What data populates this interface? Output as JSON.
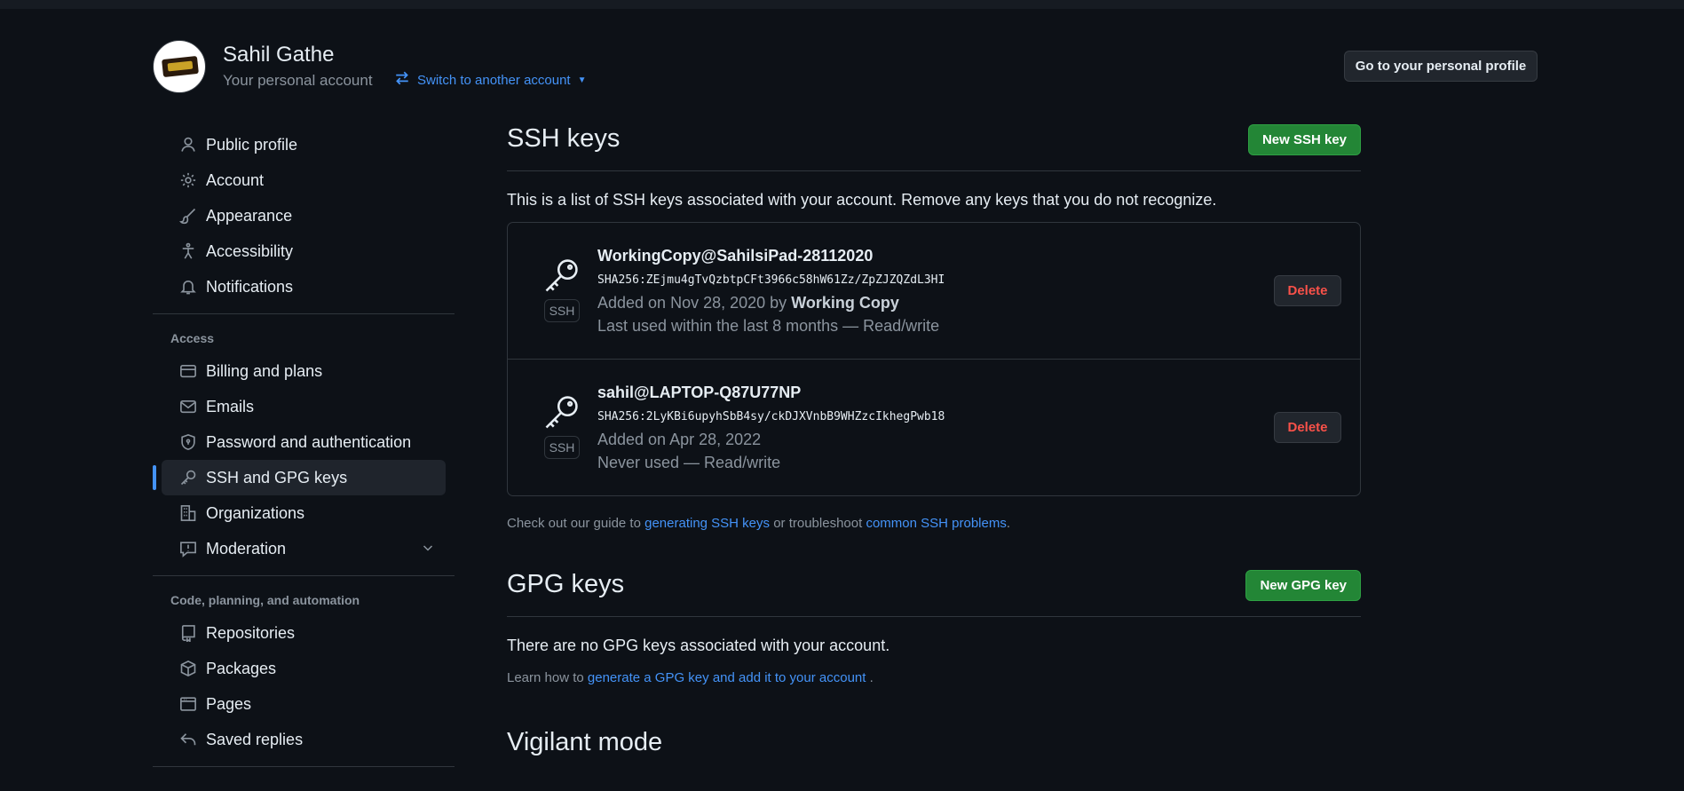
{
  "header": {
    "name": "Sahil Gathe",
    "subtitle": "Your personal account",
    "switch_label": "Switch to another account",
    "profile_button": "Go to your personal profile"
  },
  "sidebar": {
    "items_top": [
      {
        "label": "Public profile",
        "icon": "person-icon"
      },
      {
        "label": "Account",
        "icon": "gear-icon"
      },
      {
        "label": "Appearance",
        "icon": "paintbrush-icon"
      },
      {
        "label": "Accessibility",
        "icon": "accessibility-icon"
      },
      {
        "label": "Notifications",
        "icon": "bell-icon"
      }
    ],
    "access_heading": "Access",
    "items_access": [
      {
        "label": "Billing and plans",
        "icon": "credit-card-icon"
      },
      {
        "label": "Emails",
        "icon": "mail-icon"
      },
      {
        "label": "Password and authentication",
        "icon": "shield-lock-icon"
      },
      {
        "label": "SSH and GPG keys",
        "icon": "key-icon"
      },
      {
        "label": "Organizations",
        "icon": "organization-icon"
      },
      {
        "label": "Moderation",
        "icon": "report-icon"
      }
    ],
    "code_heading": "Code, planning, and automation",
    "items_code": [
      {
        "label": "Repositories",
        "icon": "repo-icon"
      },
      {
        "label": "Packages",
        "icon": "package-icon"
      },
      {
        "label": "Pages",
        "icon": "browser-icon"
      },
      {
        "label": "Saved replies",
        "icon": "reply-icon"
      }
    ]
  },
  "ssh": {
    "title": "SSH keys",
    "new_button": "New SSH key",
    "intro": "This is a list of SSH keys associated with your account. Remove any keys that you do not recognize.",
    "keys": [
      {
        "title": "WorkingCopy@SahilsiPad-28112020",
        "fingerprint": "SHA256:ZEjmu4gTvQzbtpCFt3966c58hW61Zz/ZpZJZQZdL3HI",
        "added_prefix": "Added on Nov 28, 2020 by",
        "added_by": "Working Copy",
        "used": "Last used within the last 8 months — Read/write",
        "badge": "SSH",
        "delete": "Delete"
      },
      {
        "title": "sahil@LAPTOP-Q87U77NP",
        "fingerprint": "SHA256:2LyKBi6upyhSbB4sy/ckDJXVnbB9WHZzcIkhegPwb18",
        "added_prefix": "Added on Apr 28, 2022",
        "added_by": "",
        "used": "Never used — Read/write",
        "badge": "SSH",
        "delete": "Delete"
      }
    ],
    "guide_prefix": "Check out our guide to",
    "guide_link1": "generating SSH keys",
    "guide_mid": "or troubleshoot",
    "guide_link2": "common SSH problems",
    "guide_suffix": "."
  },
  "gpg": {
    "title": "GPG keys",
    "new_button": "New GPG key",
    "empty": "There are no GPG keys associated with your account.",
    "learn_prefix": "Learn how to",
    "learn_link": "generate a GPG key and add it to your account",
    "learn_suffix": "."
  },
  "vigilant": {
    "title": "Vigilant mode"
  },
  "colors": {
    "background": "#0d1117",
    "accent": "#4493f8",
    "primary_button": "#238636",
    "danger": "#f85149"
  }
}
